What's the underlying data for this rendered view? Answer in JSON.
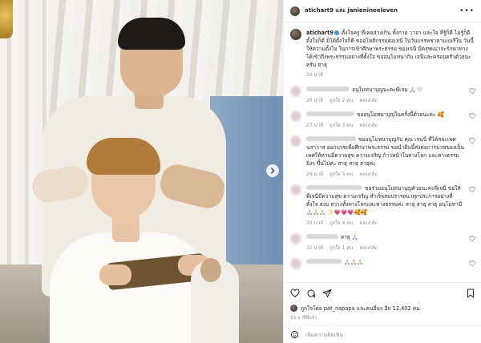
{
  "post": {
    "authors": "atichart9 และ janienineeleven",
    "caption_user": "atichart9",
    "caption_text": " ตั้งใจครู ที่เคยล่วงเกิน ทั้งกาย วาจา และใจ ที่รู้ก็ดี ไม่รู้ก็ดี ตั้งใจก็ดี มิได้ตั้งใจก็ดี ขออโหสิกรรมต่อเจนี ในวันบรรพชาสามเณรีใน วันนี้ ให้ความตั้งใจ ในการเข้าศึกษาพระธรรม ของเจนี มีครุฑเมาจะรักษาทาง ได้เข้าถึงพระธรรมอย่างที่ตั้งใจ ขออนุโมทนากับ เจนีและครอบครัวด้วยนะครับ สาธุ",
    "caption_time": "33 นาที"
  },
  "comments": [
    {
      "text": "อนุโมทนาบุญนะคะพี่เจน 🙏🏻🤍",
      "time": "26 นาที",
      "likes": "ถูกใจ 2 คน",
      "reply": "ตอบกลับ",
      "name_w": 54,
      "multiline": false
    },
    {
      "text": "ขออนุโมทนาบุญในครั้งนี้ด้วยนะคะ 🥰",
      "time": "27 นาที",
      "likes": "ถูกใจ 3 คน",
      "reply": "ตอบกลับ",
      "name_w": 60,
      "multiline": false
    },
    {
      "text": "ขออนุโมทนาบุญกับ คุณ เจนนี่ ที่ได้สละเพศฆราวาส ออกบวชเพื่อศึกษาพระธรรม ขอนำผืนนี้ส่งต่อการบวชของเป็นเพศให้ท่านมีความสุข ความเจริญ ก้าวหน้าในทางโลก และทางธรรมยิ่งๆ ขึ้นไปค่ะ สาธุ สาธุ สาธุค่ะ",
      "time": "29 นาที",
      "likes": "ถูกใจ 5 คน",
      "reply": "ตอบกลับ",
      "name_w": 62,
      "multiline": true
    },
    {
      "text": "ขอร่วมอนุโมทนาบุญด้วยนะคะพี่เจนี่ ขอให้พี่เจนี่มีความสุข ความเจริญ สำเร็จสมปรารถนาทุกประการอย่างที่ตั้งใจ สงบ สว่างทั้งทางโลกและทางธรรมค่ะ สาธุ สาธุ สาธุ อนุโมทามี 🙏🏻🙏🏻🙏🏻 ✨💗💗💗🥰🥰",
      "time": "30 นาที",
      "likes": "ถูกใจ 4 คน",
      "reply": "ตอบกลับ",
      "name_w": 70,
      "multiline": true
    },
    {
      "text": "สาธุ 🙏🏻",
      "time": "31 นาที",
      "likes": "ถูกใจ 1 คน",
      "reply": "ตอบกลับ",
      "name_w": 40,
      "multiline": false
    },
    {
      "text": "🙏🏻🙏🏻🙏🏻",
      "time": "",
      "likes": "",
      "reply": "",
      "name_w": 44,
      "multiline": false
    }
  ],
  "actions": {
    "liked_by": "ถูกใจโดย pat_napapa และคนอื่นๆ อีก 12,402 คน",
    "posted_ago": "33 นาทีที่แล้ว",
    "add_placeholder": "เพิ่มความคิดเห็น"
  },
  "icons": [
    "more-icon",
    "heart-icon",
    "comment-icon",
    "share-icon",
    "bookmark-icon",
    "emoji-icon",
    "chevron-right-icon"
  ]
}
